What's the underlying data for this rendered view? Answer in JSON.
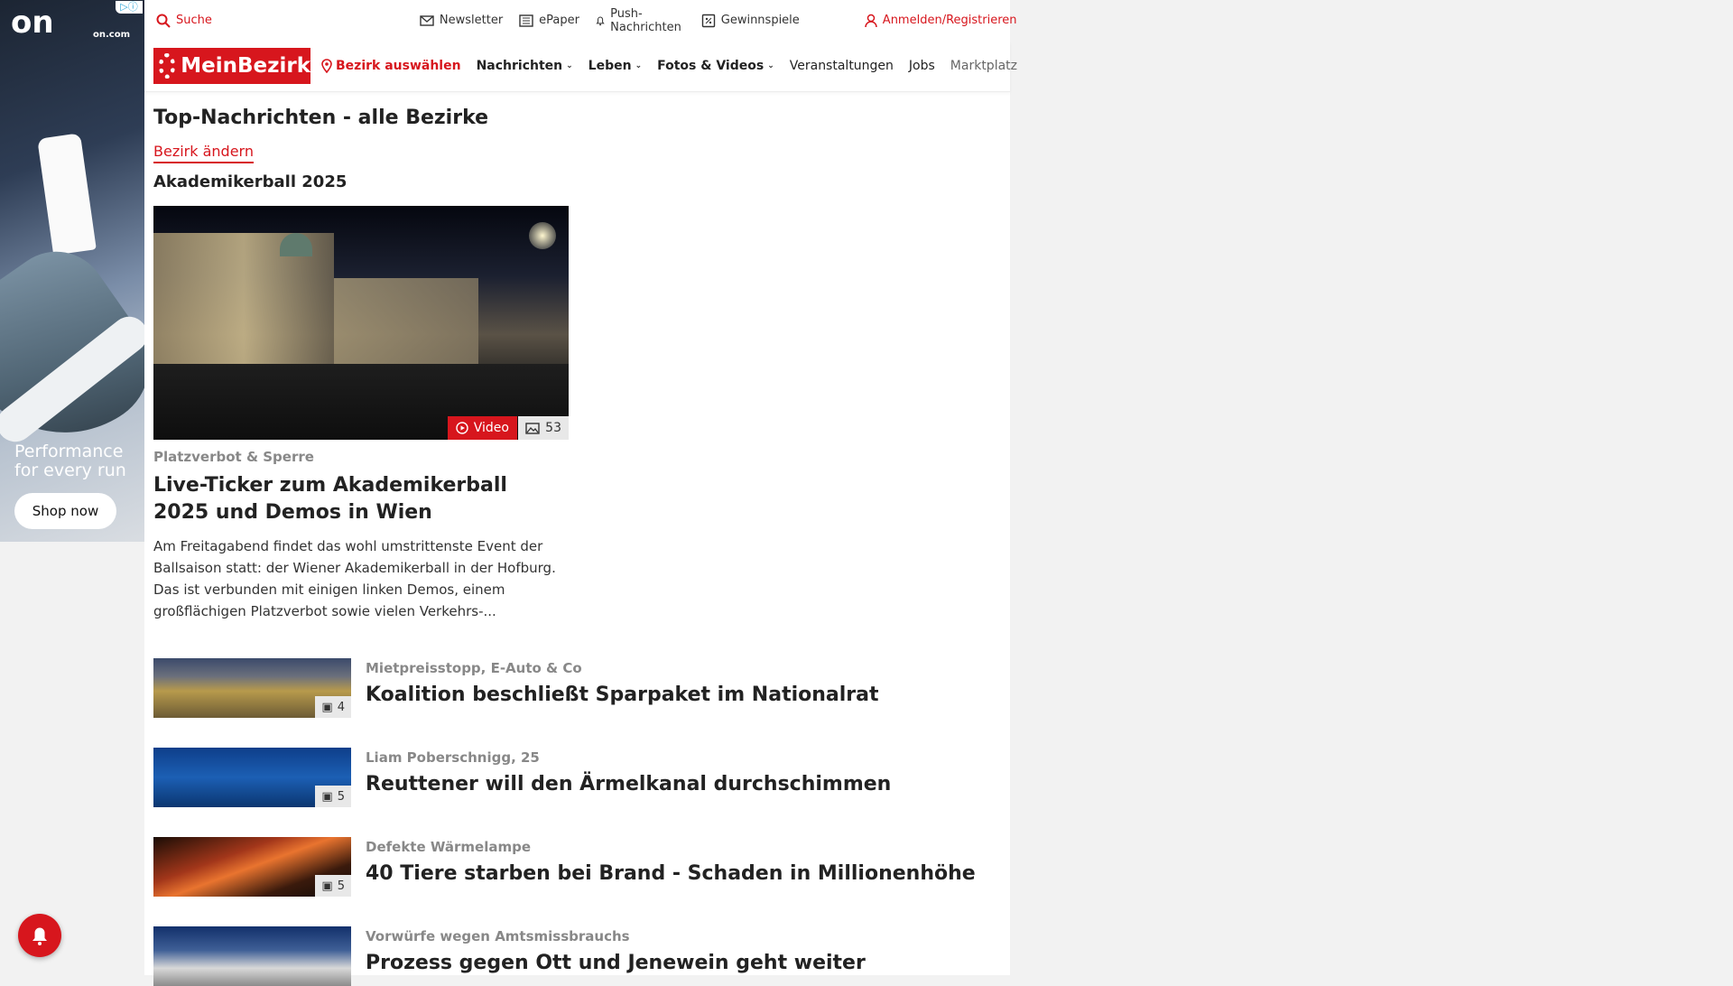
{
  "ad": {
    "logo": "on",
    "url": "on.com",
    "headline": "Performance for every run",
    "cta": "Shop now"
  },
  "topbar": {
    "search": "Suche",
    "newsletter": "Newsletter",
    "epaper": "ePaper",
    "push": "Push-Nachrichten",
    "contests": "Gewinnspiele",
    "login": "Anmelden/Registrieren"
  },
  "nav": {
    "logo": "MeinBezirk",
    "select_district": "Bezirk auswählen",
    "items": [
      "Nachrichten",
      "Leben",
      "Fotos & Videos",
      "Veranstaltungen",
      "Jobs",
      "Marktplatz"
    ]
  },
  "main": {
    "title": "Top-Nachrichten - alle Bezirke",
    "change_district": "Bezirk ändern",
    "topic": "Akademikerball 2025",
    "hero": {
      "video_label": "Video",
      "photo_count": "53",
      "kicker": "Platzverbot & Sperre",
      "title": "Live-Ticker zum Akademikerball 2025 und Demos in Wien",
      "teaser": "Am Freitagabend findet das wohl umstrittenste Event der Ballsaison statt: der Wiener Akademikerball in der Hofburg. Das ist verbunden mit einigen linken Demos, einem großflächigen Platzverbot sowie vielen Verkehrs-..."
    },
    "articles": [
      {
        "kicker": "Mietpreisstopp, E-Auto & Co",
        "title": "Koalition beschließt Sparpaket im Nationalrat",
        "count": "4"
      },
      {
        "kicker": "Liam Poberschnigg, 25",
        "title": "Reuttener will den Ärmelkanal durchschimmen",
        "count": "5"
      },
      {
        "kicker": "Defekte Wärmelampe",
        "title": "40 Tiere starben bei Brand - Schaden in Millionenhöhe",
        "count": "5"
      },
      {
        "kicker": "Vorwürfe wegen Amtsmissbrauchs",
        "title": "Prozess gegen Ott und Jenewein geht weiter",
        "count": ""
      }
    ]
  },
  "colors": {
    "brand": "#d7161d"
  }
}
